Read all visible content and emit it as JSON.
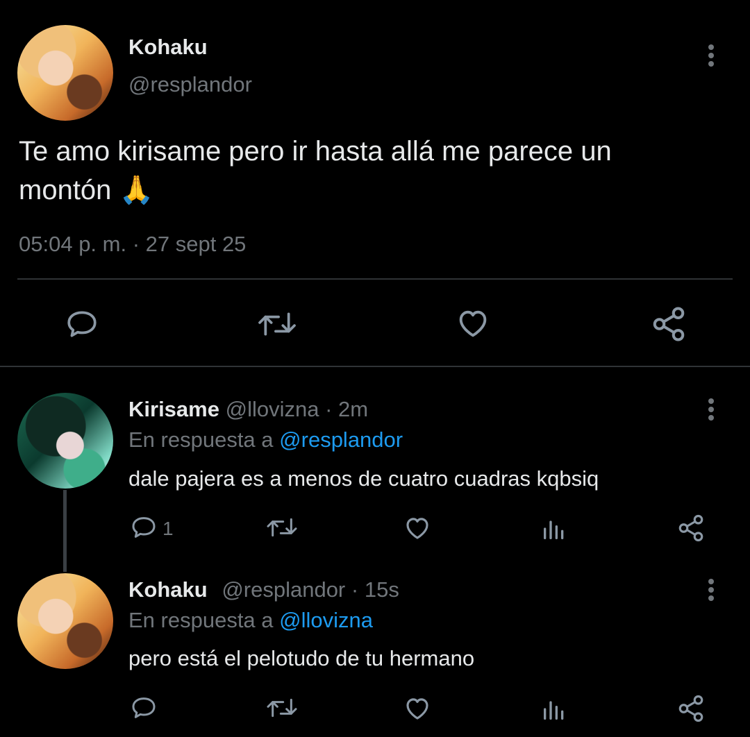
{
  "main_tweet": {
    "display_name": "Kohaku",
    "handle": "@resplandor",
    "text": "Te amo kirisame pero ir hasta allá me parece un",
    "text_line2": "montón 🙏",
    "timestamp": "05:04 p. m. · 27 sept 25"
  },
  "replies": [
    {
      "display_name": "Kirisame",
      "handle": "@llovizna",
      "sep": "·",
      "time": "2m",
      "reply_prefix": "En respuesta a",
      "reply_to": "@resplandor",
      "text": "dale pajera es a menos de cuatro cuadras kqbsiq",
      "reply_count": "1"
    },
    {
      "display_name": "Kohaku",
      "handle": "@resplandor",
      "sep": "·",
      "time": "15s",
      "reply_prefix": "En respuesta a",
      "reply_to": "@llovizna",
      "text": "pero está el pelotudo de tu hermano",
      "reply_count": ""
    }
  ],
  "icons": [
    "reply-icon",
    "retweet-icon",
    "like-icon",
    "views-icon",
    "share-icon",
    "more-icon"
  ],
  "colors": {
    "background": "#000000",
    "text": "#e7e9ea",
    "muted": "#71767b",
    "link": "#1d9bf0",
    "divider": "#2f3336"
  }
}
